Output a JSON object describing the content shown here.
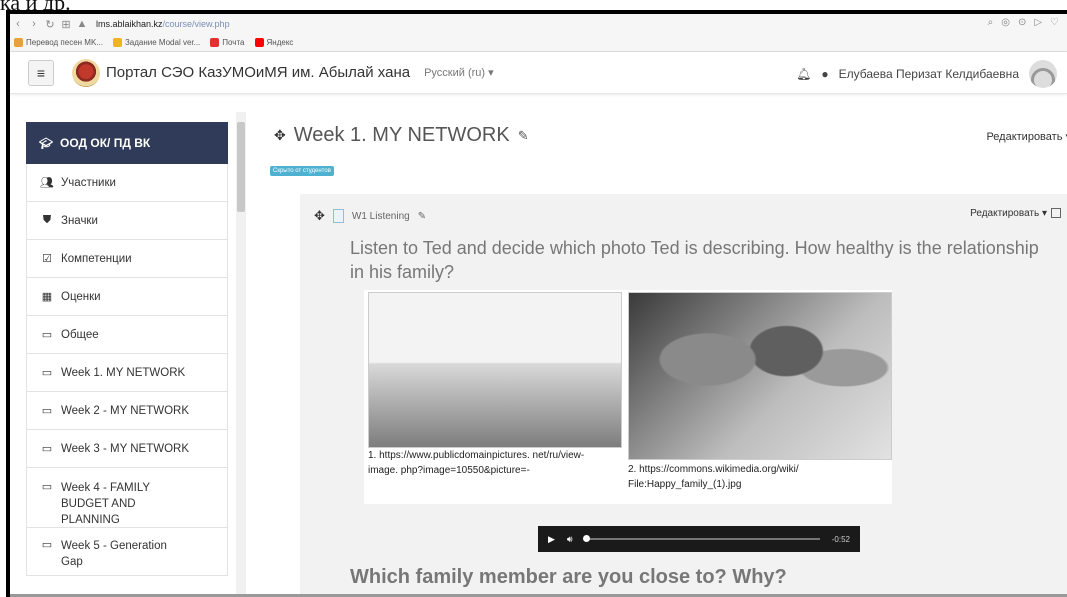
{
  "doc_fragment": "ка и др.",
  "browser": {
    "url_host": "lms.ablaikhan.kz",
    "url_path": "/course/view.php",
    "bookmarks": [
      {
        "label": "Перевод песен MK...",
        "color": "#e8a23a"
      },
      {
        "label": "Задание Modal ver...",
        "color": "#f0b323"
      },
      {
        "label": "Почта",
        "color": "#e3312f"
      },
      {
        "label": "Яндекс",
        "color": "#ff0000"
      }
    ]
  },
  "navbar": {
    "brand": "Портал СЭО КазУМОиМЯ им. Абылай хана",
    "language": "Русский (ru) ▾",
    "user_name": "Елубаева Перизат Келдибаевна"
  },
  "sidebar": {
    "items": [
      {
        "label": "ООД ОК/ ПД ВК",
        "icon": "graduation-cap-icon",
        "glyph": "🎓"
      },
      {
        "label": "Участники",
        "icon": "users-icon",
        "glyph": "👥"
      },
      {
        "label": "Значки",
        "icon": "shield-icon",
        "glyph": "⛊"
      },
      {
        "label": "Компетенции",
        "icon": "checkbox-icon",
        "glyph": "☑"
      },
      {
        "label": "Оценки",
        "icon": "table-icon",
        "glyph": "▦"
      },
      {
        "label": "Общее",
        "icon": "folder-icon",
        "glyph": "▭"
      },
      {
        "label": "Week 1. MY NETWORK",
        "icon": "folder-icon",
        "glyph": "▭"
      },
      {
        "label": "Week 2 - MY NETWORK",
        "icon": "folder-icon",
        "glyph": "▭"
      },
      {
        "label": "Week 3 - MY NETWORK",
        "icon": "folder-icon",
        "glyph": "▭"
      },
      {
        "label": "Week 4 - FAMILY BUDGET AND PLANNING",
        "icon": "folder-icon",
        "glyph": "▭"
      },
      {
        "label": "Week 5 - Generation Gap",
        "icon": "folder-icon",
        "glyph": "▭"
      }
    ]
  },
  "main": {
    "section_title": "Week 1. MY NETWORK",
    "edit_label": "Редактировать ▾",
    "hidden_badge": "Скрыто от студентов",
    "activity": {
      "title": "W1 Listening",
      "edit_label": "Редактировать ▾",
      "prompt": "Listen to Ted and decide which photo Ted is describing. How healthy is the relationship in his family?",
      "caption1": "1. https://www.publicdomainpictures. net/ru/view-image. php?image=10550&picture=-",
      "caption2": "2. https://commons.wikimedia.org/wiki/ File:Happy_family_(1).jpg",
      "player_time": "-0:52",
      "question2": "Which family member are you close to? Why?"
    }
  }
}
